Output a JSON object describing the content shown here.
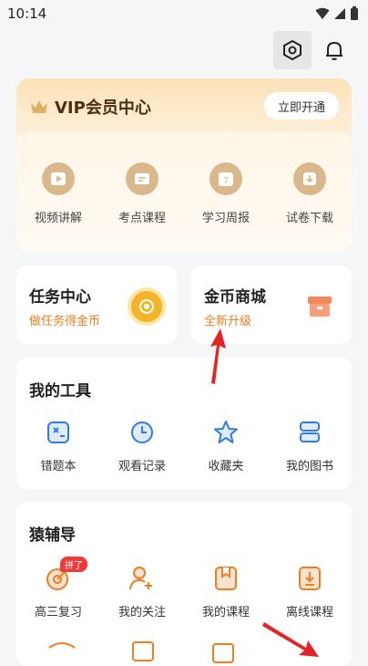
{
  "status_bar": {
    "time": "10:14"
  },
  "vip": {
    "title": "VIP会员中心",
    "open_button": "立即开通",
    "items": [
      {
        "label": "视频讲解"
      },
      {
        "label": "考点课程"
      },
      {
        "label": "学习周报",
        "icon_text": "7"
      },
      {
        "label": "试卷下载"
      }
    ]
  },
  "task": {
    "title": "任务中心",
    "subtitle": "做任务得金币"
  },
  "coin_mall": {
    "title": "金币商城",
    "subtitle": "全新升级"
  },
  "tools": {
    "title": "我的工具",
    "items": [
      {
        "label": "错题本"
      },
      {
        "label": "观看记录"
      },
      {
        "label": "收藏夹"
      },
      {
        "label": "我的图书"
      }
    ]
  },
  "guide": {
    "title": "猿辅导",
    "items": [
      {
        "label": "高三复习",
        "badge": "拼了"
      },
      {
        "label": "我的关注"
      },
      {
        "label": "我的课程"
      },
      {
        "label": "离线课程"
      }
    ]
  },
  "colors": {
    "accent_blue": "#2f7de1",
    "orange": "#f07d1e",
    "arrow_red": "#e32424",
    "vip_gold": "#d9b98b"
  }
}
